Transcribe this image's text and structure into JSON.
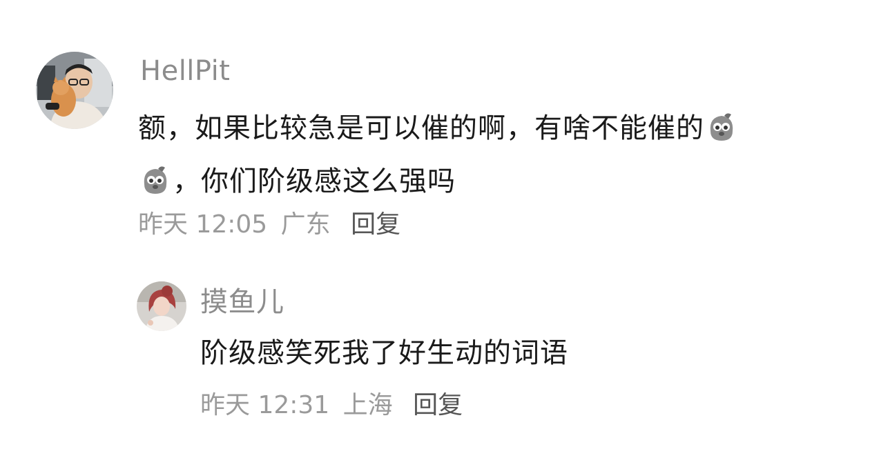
{
  "comments": [
    {
      "username": "HellPit",
      "text_part1": "额，如果比较急是可以催的啊，有啥不能催的",
      "text_emojis": [
        "sad-face-emoji",
        "sad-face-emoji"
      ],
      "text_part2": "，你们阶级感这么强吗",
      "time": "昨天 12:05",
      "location": "广东",
      "reply_label": "回复"
    },
    {
      "username": "摸鱼儿",
      "text": "阶级感笑死我了好生动的词语",
      "time": "昨天 12:31",
      "location": "上海",
      "reply_label": "回复"
    }
  ]
}
